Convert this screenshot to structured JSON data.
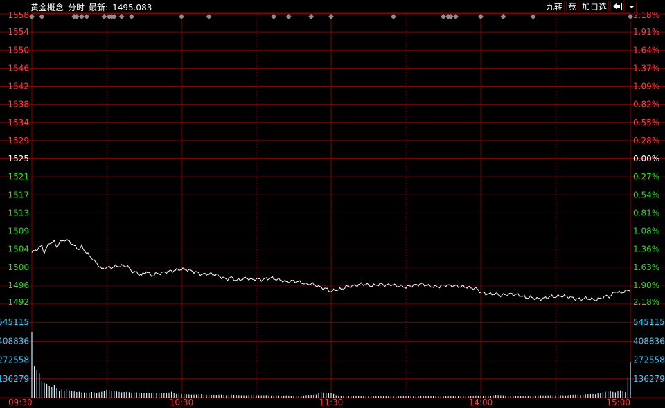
{
  "header": {
    "name": "黄金概念",
    "mode": "分时",
    "latest_label": "最新:",
    "latest_value": "1495.083",
    "buttons": [
      "九转",
      "竞",
      "加自选"
    ],
    "arrow_icon": "exit-arrow-icon",
    "dropdown_icon": "chevron-down-icon"
  },
  "colors": {
    "background": "#000000",
    "grid": "#8b0000",
    "price_line": "#ffffff",
    "up": "#ff3b3b",
    "down": "#1ee31e",
    "volume": "#cdeefa",
    "volume_label": "#33ccff",
    "time_label": "#ff3b3b",
    "marker": "#8c8c8c"
  },
  "chart_data": {
    "type": "line",
    "prev_close": 1525,
    "price_ticks": [
      "1558",
      "1554",
      "1550",
      "1546",
      "1542",
      "1538",
      "1534",
      "1529",
      "1525",
      "1521",
      "1517",
      "1513",
      "1509",
      "1504",
      "1500",
      "1496",
      "1492"
    ],
    "pct_ticks": [
      "2.18%",
      "1.91%",
      "1.64%",
      "1.37%",
      "1.09%",
      "0.82%",
      "0.55%",
      "0.28%",
      "0.00%",
      "0.27%",
      "0.54%",
      "0.81%",
      "1.08%",
      "1.36%",
      "1.63%",
      "1.90%",
      "2.18%"
    ],
    "ylim": [
      1492,
      1558
    ],
    "volume_ticks": [
      "545115",
      "408836",
      "272558",
      "136279"
    ],
    "volume_max": 681394,
    "time_labels": [
      "09:30",
      "10:30",
      "11:30",
      "14:00",
      "15:00"
    ],
    "minutes_total": 240,
    "price_keypoints": [
      [
        0,
        1503.6
      ],
      [
        2,
        1504.3
      ],
      [
        4,
        1505.1
      ],
      [
        5,
        1503.6
      ],
      [
        7,
        1505.8
      ],
      [
        9,
        1506.0
      ],
      [
        10,
        1504.9
      ],
      [
        11,
        1505.8
      ],
      [
        13,
        1506.5
      ],
      [
        15,
        1506.2
      ],
      [
        17,
        1505.1
      ],
      [
        19,
        1504.3
      ],
      [
        20,
        1505.0
      ],
      [
        22,
        1503.4
      ],
      [
        24,
        1502.4
      ],
      [
        25,
        1501.6
      ],
      [
        26,
        1501.2
      ],
      [
        28,
        1499.8
      ],
      [
        30,
        1500.2
      ],
      [
        32,
        1500.2
      ],
      [
        34,
        1500.5
      ],
      [
        36,
        1500.5
      ],
      [
        38,
        1500.6
      ],
      [
        40,
        1499.4
      ],
      [
        42,
        1499.0
      ],
      [
        44,
        1498.4
      ],
      [
        46,
        1499.3
      ],
      [
        48,
        1498.3
      ],
      [
        50,
        1498.8
      ],
      [
        52,
        1498.9
      ],
      [
        54,
        1499.2
      ],
      [
        56,
        1499.4
      ],
      [
        58,
        1499.6
      ],
      [
        60,
        1499.8
      ],
      [
        62,
        1499.7
      ],
      [
        64,
        1499.4
      ],
      [
        66,
        1499.1
      ],
      [
        68,
        1498.6
      ],
      [
        70,
        1498.7
      ],
      [
        72,
        1498.7
      ],
      [
        74,
        1498.5
      ],
      [
        76,
        1498.0
      ],
      [
        78,
        1497.5
      ],
      [
        80,
        1497.9
      ],
      [
        82,
        1497.2
      ],
      [
        84,
        1497.5
      ],
      [
        86,
        1497.8
      ],
      [
        88,
        1497.4
      ],
      [
        90,
        1497.6
      ],
      [
        92,
        1497.4
      ],
      [
        94,
        1497.6
      ],
      [
        96,
        1497.8
      ],
      [
        98,
        1497.5
      ],
      [
        100,
        1497.3
      ],
      [
        102,
        1496.9
      ],
      [
        104,
        1497.1
      ],
      [
        106,
        1497.0
      ],
      [
        108,
        1496.8
      ],
      [
        110,
        1496.3
      ],
      [
        112,
        1496.5
      ],
      [
        114,
        1496.1
      ],
      [
        116,
        1495.6
      ],
      [
        118,
        1495.3
      ],
      [
        120,
        1494.7
      ],
      [
        122,
        1495.1
      ],
      [
        124,
        1495.2
      ],
      [
        126,
        1495.8
      ],
      [
        128,
        1495.9
      ],
      [
        130,
        1496.1
      ],
      [
        132,
        1496.4
      ],
      [
        134,
        1496.3
      ],
      [
        136,
        1496.0
      ],
      [
        138,
        1496.2
      ],
      [
        140,
        1496.4
      ],
      [
        142,
        1496.1
      ],
      [
        144,
        1496.3
      ],
      [
        146,
        1496.0
      ],
      [
        148,
        1495.9
      ],
      [
        150,
        1495.7
      ],
      [
        152,
        1496.0
      ],
      [
        154,
        1496.2
      ],
      [
        156,
        1496.4
      ],
      [
        158,
        1496.2
      ],
      [
        160,
        1495.9
      ],
      [
        162,
        1495.8
      ],
      [
        164,
        1495.9
      ],
      [
        166,
        1496.2
      ],
      [
        168,
        1496.0
      ],
      [
        170,
        1496.0
      ],
      [
        172,
        1495.8
      ],
      [
        174,
        1495.8
      ],
      [
        176,
        1495.5
      ],
      [
        178,
        1495.4
      ],
      [
        180,
        1494.6
      ],
      [
        182,
        1494.2
      ],
      [
        184,
        1494.1
      ],
      [
        186,
        1494.2
      ],
      [
        188,
        1493.8
      ],
      [
        190,
        1494.0
      ],
      [
        192,
        1494.1
      ],
      [
        194,
        1494.0
      ],
      [
        196,
        1493.8
      ],
      [
        198,
        1493.3
      ],
      [
        200,
        1493.4
      ],
      [
        202,
        1493.1
      ],
      [
        204,
        1493.0
      ],
      [
        206,
        1493.2
      ],
      [
        208,
        1493.6
      ],
      [
        210,
        1493.5
      ],
      [
        212,
        1493.7
      ],
      [
        214,
        1493.6
      ],
      [
        216,
        1493.4
      ],
      [
        218,
        1493.0
      ],
      [
        220,
        1492.9
      ],
      [
        222,
        1493.2
      ],
      [
        224,
        1493.0
      ],
      [
        226,
        1492.8
      ],
      [
        228,
        1493.1
      ],
      [
        230,
        1493.6
      ],
      [
        232,
        1493.6
      ],
      [
        234,
        1494.8
      ],
      [
        236,
        1494.4
      ],
      [
        238,
        1494.8
      ],
      [
        240,
        1495.1
      ]
    ],
    "volume_keypoints": [
      [
        0,
        475000
      ],
      [
        1,
        225000
      ],
      [
        2,
        200000
      ],
      [
        3,
        175000
      ],
      [
        4,
        120000
      ],
      [
        5,
        105000
      ],
      [
        6,
        95000
      ],
      [
        7,
        85000
      ],
      [
        8,
        80000
      ],
      [
        9,
        90000
      ],
      [
        10,
        70000
      ],
      [
        11,
        50000
      ],
      [
        12,
        58000
      ],
      [
        13,
        45000
      ],
      [
        14,
        60000
      ],
      [
        15,
        52000
      ],
      [
        16,
        50000
      ],
      [
        17,
        44000
      ],
      [
        18,
        40000
      ],
      [
        19,
        42000
      ],
      [
        20,
        38000
      ],
      [
        22,
        36000
      ],
      [
        24,
        40000
      ],
      [
        26,
        34000
      ],
      [
        28,
        42000
      ],
      [
        30,
        55000
      ],
      [
        32,
        50000
      ],
      [
        34,
        44000
      ],
      [
        36,
        38000
      ],
      [
        38,
        42000
      ],
      [
        40,
        36000
      ],
      [
        42,
        38000
      ],
      [
        44,
        33000
      ],
      [
        46,
        32000
      ],
      [
        48,
        35000
      ],
      [
        50,
        30000
      ],
      [
        52,
        34000
      ],
      [
        54,
        30000
      ],
      [
        56,
        42000
      ],
      [
        58,
        26000
      ],
      [
        60,
        26000
      ],
      [
        62,
        24000
      ],
      [
        64,
        22000
      ],
      [
        66,
        22000
      ],
      [
        68,
        25000
      ],
      [
        70,
        20000
      ],
      [
        72,
        21000
      ],
      [
        74,
        20000
      ],
      [
        76,
        22000
      ],
      [
        78,
        18000
      ],
      [
        80,
        22000
      ],
      [
        82,
        19000
      ],
      [
        84,
        18000
      ],
      [
        86,
        17000
      ],
      [
        88,
        20000
      ],
      [
        90,
        19000
      ],
      [
        92,
        17000
      ],
      [
        94,
        18000
      ],
      [
        96,
        16000
      ],
      [
        98,
        18000
      ],
      [
        100,
        15000
      ],
      [
        102,
        17000
      ],
      [
        104,
        15000
      ],
      [
        106,
        16000
      ],
      [
        108,
        14000
      ],
      [
        110,
        18000
      ],
      [
        112,
        20000
      ],
      [
        114,
        22000
      ],
      [
        116,
        42000
      ],
      [
        118,
        30000
      ],
      [
        120,
        35000
      ],
      [
        122,
        18000
      ],
      [
        124,
        14000
      ],
      [
        126,
        13000
      ],
      [
        128,
        12000
      ],
      [
        130,
        13000
      ],
      [
        132,
        14000
      ],
      [
        134,
        12000
      ],
      [
        136,
        13000
      ],
      [
        138,
        12000
      ],
      [
        140,
        11000
      ],
      [
        142,
        13000
      ],
      [
        144,
        12000
      ],
      [
        146,
        13000
      ],
      [
        148,
        11000
      ],
      [
        150,
        12000
      ],
      [
        152,
        13000
      ],
      [
        154,
        12000
      ],
      [
        156,
        13000
      ],
      [
        158,
        12000
      ],
      [
        160,
        14000
      ],
      [
        162,
        12000
      ],
      [
        164,
        13000
      ],
      [
        166,
        12000
      ],
      [
        168,
        13000
      ],
      [
        170,
        12000
      ],
      [
        172,
        14000
      ],
      [
        174,
        13000
      ],
      [
        176,
        14000
      ],
      [
        178,
        16000
      ],
      [
        180,
        15000
      ],
      [
        182,
        14000
      ],
      [
        184,
        13000
      ],
      [
        186,
        20000
      ],
      [
        188,
        18000
      ],
      [
        190,
        16000
      ],
      [
        192,
        14000
      ],
      [
        194,
        15000
      ],
      [
        196,
        14000
      ],
      [
        198,
        13000
      ],
      [
        200,
        15000
      ],
      [
        202,
        16000
      ],
      [
        204,
        17000
      ],
      [
        206,
        16000
      ],
      [
        208,
        18000
      ],
      [
        210,
        17000
      ],
      [
        212,
        18000
      ],
      [
        214,
        16000
      ],
      [
        216,
        20000
      ],
      [
        218,
        22000
      ],
      [
        220,
        20000
      ],
      [
        222,
        24000
      ],
      [
        224,
        26000
      ],
      [
        226,
        24000
      ],
      [
        228,
        35000
      ],
      [
        230,
        42000
      ],
      [
        232,
        45000
      ],
      [
        234,
        38000
      ],
      [
        236,
        52000
      ],
      [
        238,
        40000
      ],
      [
        240,
        255000
      ]
    ],
    "markers": [
      0,
      4,
      17,
      18,
      20,
      22,
      29,
      31,
      32,
      33,
      36,
      40,
      60,
      71,
      97,
      103,
      112,
      120,
      145,
      165,
      167,
      168,
      170,
      180,
      189,
      201,
      240
    ]
  }
}
